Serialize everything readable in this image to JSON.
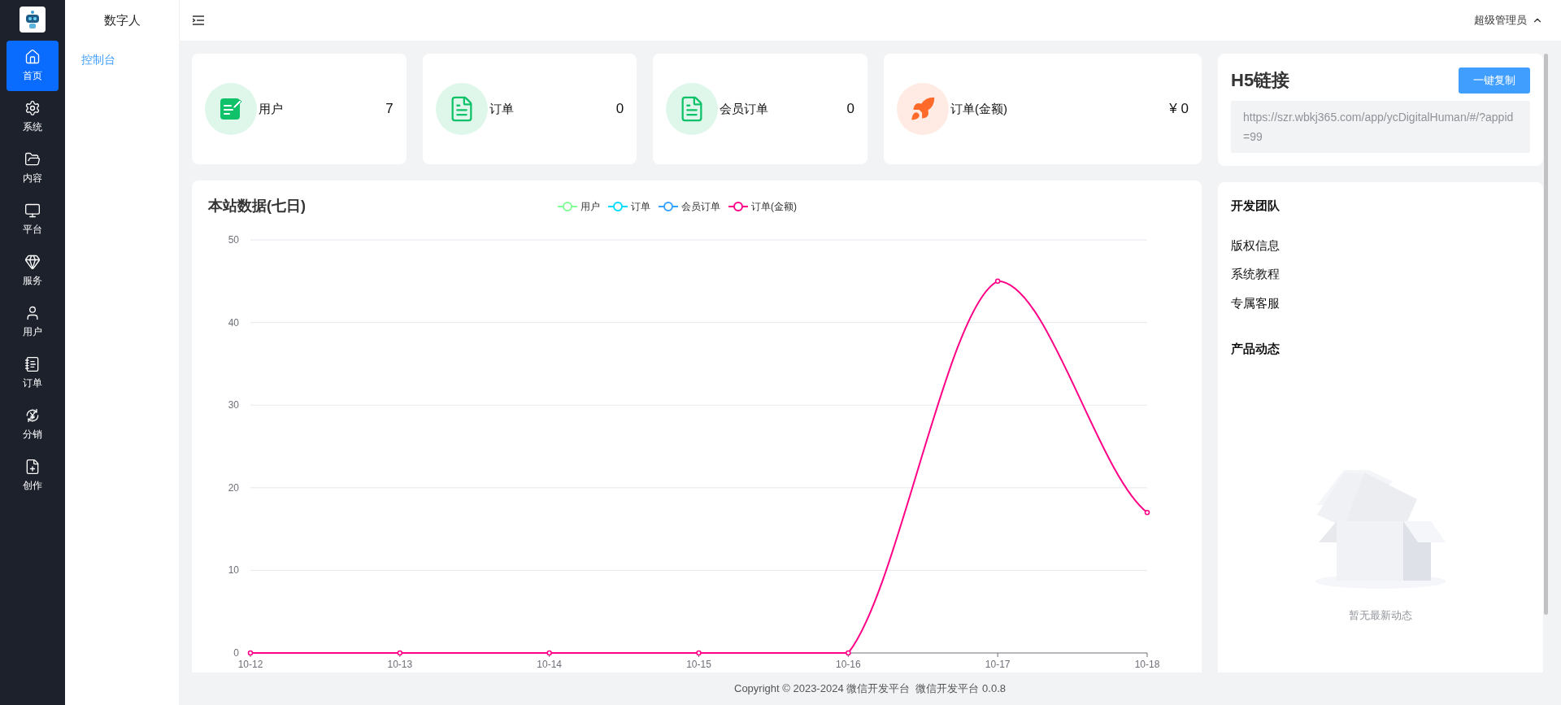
{
  "nav_rail": [
    {
      "label": "首页",
      "selected": true
    },
    {
      "label": "系统",
      "selected": false
    },
    {
      "label": "内容",
      "selected": false
    },
    {
      "label": "平台",
      "selected": false
    },
    {
      "label": "服务",
      "selected": false
    },
    {
      "label": "用户",
      "selected": false
    },
    {
      "label": "订单",
      "selected": false
    },
    {
      "label": "分销",
      "selected": false
    },
    {
      "label": "创作",
      "selected": false
    }
  ],
  "sidebar": {
    "title": "数字人",
    "items": [
      {
        "label": "控制台",
        "selected": true
      }
    ]
  },
  "header": {
    "user": "超级管理员"
  },
  "stats": [
    {
      "label": "用户",
      "value": "7",
      "color": "#0fc26a"
    },
    {
      "label": "订单",
      "value": "0",
      "color": "#0fc26a"
    },
    {
      "label": "会员订单",
      "value": "0",
      "color": "#0fc26a"
    },
    {
      "label": "订单(金额)",
      "value": "¥ 0",
      "color": "#ff6a2a"
    }
  ],
  "h5_link": {
    "title": "H5链接",
    "button": "一键复制",
    "url": "https://szr.wbkj365.com/app/ycDigitalHuman/#/?appid=99"
  },
  "chart_panel": {
    "title": "本站数据(七日)",
    "chart_data": {
      "type": "line",
      "categories": [
        "10-12",
        "10-13",
        "10-14",
        "10-15",
        "10-16",
        "10-17",
        "10-18"
      ],
      "ylim": [
        0,
        50
      ],
      "yticks": [
        0,
        10,
        20,
        30,
        40,
        50
      ],
      "grid": true,
      "series": [
        {
          "name": "用户",
          "color": "#80ff95",
          "values": [
            null,
            null,
            null,
            null,
            null,
            null,
            null
          ]
        },
        {
          "name": "订单",
          "color": "#00ddff",
          "values": [
            null,
            null,
            null,
            null,
            null,
            null,
            null
          ]
        },
        {
          "name": "会员订单",
          "color": "#37a2ff",
          "values": [
            null,
            null,
            null,
            null,
            null,
            null,
            null
          ]
        },
        {
          "name": "订单(金额)",
          "color": "#ff0087",
          "marker": true,
          "values": [
            0,
            0,
            0,
            0,
            0,
            45,
            17
          ]
        }
      ]
    }
  },
  "team_panel": {
    "title": "开发团队",
    "links": [
      "版权信息",
      "系统教程",
      "专属客服"
    ],
    "news_title": "产品动态",
    "empty_text": "暂无最新动态"
  },
  "footer": "Copyright © 2023-2024 微信开发平台  微信开发平台 0.0.8"
}
